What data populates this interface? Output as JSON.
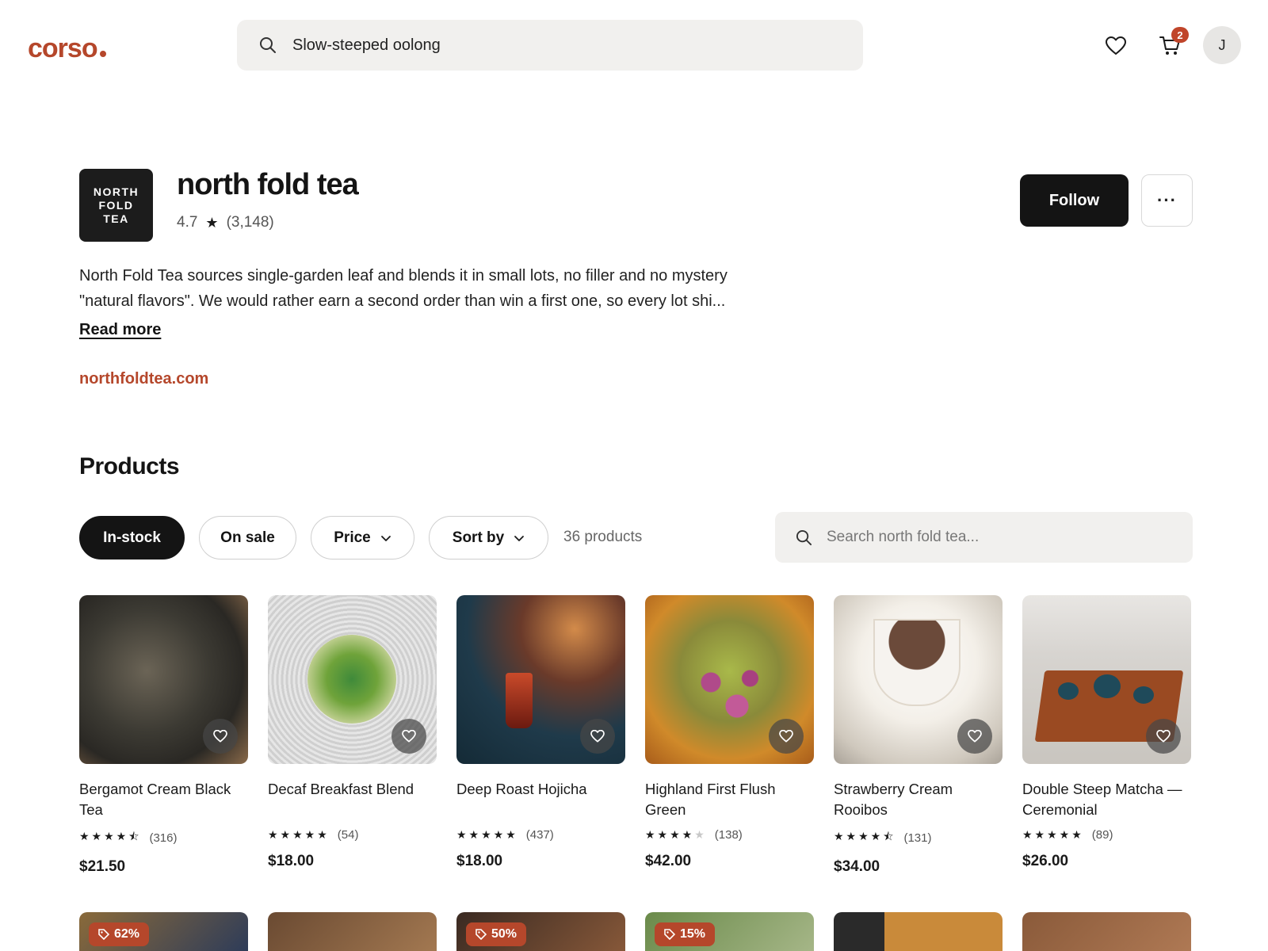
{
  "header": {
    "logo": "corso",
    "search_value": "Slow-steeped oolong",
    "cart_count": "2",
    "avatar_initial": "J"
  },
  "shop": {
    "logo_lines": [
      "NORTH",
      "FOLD",
      "TEA"
    ],
    "name": "north fold tea",
    "rating": "4.7",
    "review_count": "(3,148)",
    "follow_label": "Follow",
    "more_label": "···",
    "description": "North Fold Tea sources single-garden leaf and blends it in small lots, no filler and no mystery \"natural flavors\". We would rather earn a second order than win a first one, so every lot shi...",
    "read_more": "Read more",
    "website": "northfoldtea.com"
  },
  "products_section": {
    "title": "Products",
    "filters": [
      "In-stock",
      "On sale",
      "Price",
      "Sort by"
    ],
    "count": "36 products",
    "search_placeholder": "Search north fold tea..."
  },
  "products": [
    {
      "name": "Bergamot Cream Black Tea",
      "rating": 4.5,
      "reviews": "(316)",
      "price": "$21.50"
    },
    {
      "name": "Decaf Breakfast Blend",
      "rating": 5.0,
      "reviews": "(54)",
      "price": "$18.00"
    },
    {
      "name": "Deep Roast Hojicha",
      "rating": 5.0,
      "reviews": "(437)",
      "price": "$18.00"
    },
    {
      "name": "Highland First Flush Green",
      "rating": 4.0,
      "reviews": "(138)",
      "price": "$42.00"
    },
    {
      "name": "Strawberry Cream Rooibos",
      "rating": 4.5,
      "reviews": "(131)",
      "price": "$34.00"
    },
    {
      "name": "Double Steep Matcha — Ceremonial",
      "rating": 4.8,
      "reviews": "(89)",
      "price": "$26.00"
    }
  ],
  "next_row_sale_badges": [
    "62%",
    "50%",
    "15%"
  ],
  "colors": {
    "brand": "#b5472b",
    "primary_dark": "#141414",
    "surface": "#f1f0ee"
  },
  "icons": {
    "search": "search-icon",
    "favorite": "heart-icon",
    "cart": "cart-icon",
    "more": "ellipsis-icon",
    "chevron": "chevron-down-icon",
    "sale_tag": "tag-icon"
  }
}
